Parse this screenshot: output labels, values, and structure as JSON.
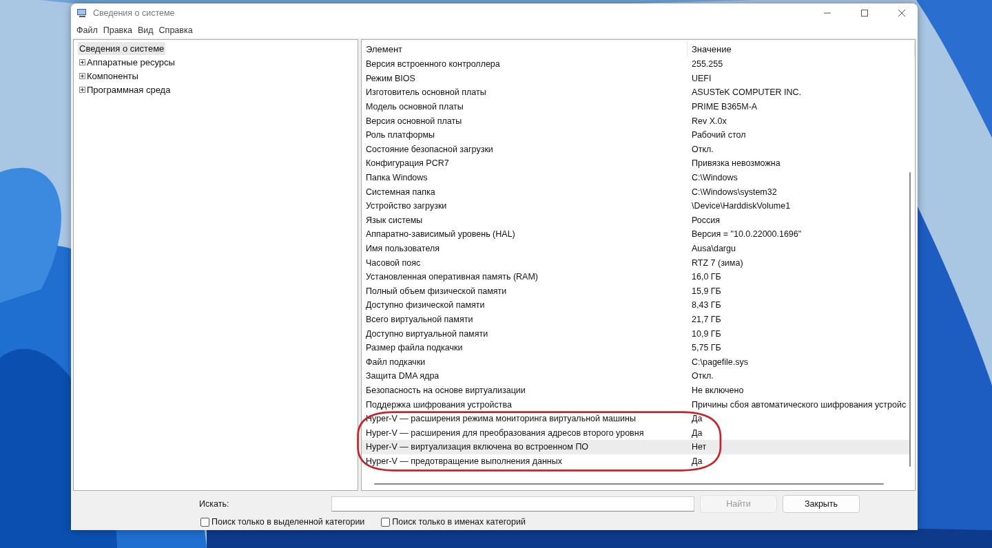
{
  "window": {
    "title": "Сведения о системе"
  },
  "menu": [
    "Файл",
    "Правка",
    "Вид",
    "Справка"
  ],
  "tree": {
    "root": {
      "label": "Сведения о системе",
      "selected": true
    },
    "children": [
      {
        "label": "Аппаратные ресурсы",
        "expanded": false
      },
      {
        "label": "Компоненты",
        "expanded": false
      },
      {
        "label": "Программная среда",
        "expanded": false
      }
    ]
  },
  "table": {
    "columns": [
      "Элемент",
      "Значение"
    ],
    "rows": [
      {
        "item": "Версия встроенного контроллера",
        "value": "255.255",
        "selected": false
      },
      {
        "item": "Режим BIOS",
        "value": "UEFI",
        "selected": false
      },
      {
        "item": "Изготовитель основной платы",
        "value": "ASUSTeK COMPUTER INC.",
        "selected": false
      },
      {
        "item": "Модель основной платы",
        "value": "PRIME B365M-A",
        "selected": false
      },
      {
        "item": "Версия основной платы",
        "value": "Rev X.0x",
        "selected": false
      },
      {
        "item": "Роль платформы",
        "value": "Рабочий стол",
        "selected": false
      },
      {
        "item": "Состояние безопасной загрузки",
        "value": "Откл.",
        "selected": false
      },
      {
        "item": "Конфигурация PCR7",
        "value": "Привязка невозможна",
        "selected": false
      },
      {
        "item": "Папка Windows",
        "value": "C:\\Windows",
        "selected": false
      },
      {
        "item": "Системная папка",
        "value": "C:\\Windows\\system32",
        "selected": false
      },
      {
        "item": "Устройство загрузки",
        "value": "\\Device\\HarddiskVolume1",
        "selected": false
      },
      {
        "item": "Язык системы",
        "value": "Россия",
        "selected": false
      },
      {
        "item": "Аппаратно-зависимый уровень (HAL)",
        "value": "Версия = \"10.0.22000.1696\"",
        "selected": false
      },
      {
        "item": "Имя пользователя",
        "value": "Ausa\\dargu",
        "selected": false
      },
      {
        "item": "Часовой пояс",
        "value": "RTZ 7 (зима)",
        "selected": false
      },
      {
        "item": "Установленная оперативная память (RAM)",
        "value": "16,0 ГБ",
        "selected": false
      },
      {
        "item": "Полный объем физической памяти",
        "value": "15,9 ГБ",
        "selected": false
      },
      {
        "item": "Доступно физической памяти",
        "value": "8,43 ГБ",
        "selected": false
      },
      {
        "item": "Всего виртуальной памяти",
        "value": "21,7 ГБ",
        "selected": false
      },
      {
        "item": "Доступно виртуальной памяти",
        "value": "10,9 ГБ",
        "selected": false
      },
      {
        "item": "Размер файла подкачки",
        "value": "5,75 ГБ",
        "selected": false
      },
      {
        "item": "Файл подкачки",
        "value": "C:\\pagefile.sys",
        "selected": false
      },
      {
        "item": "Защита DMA ядра",
        "value": "Откл.",
        "selected": false
      },
      {
        "item": "Безопасность на основе виртуализации",
        "value": "Не включено",
        "selected": false
      },
      {
        "item": "Поддержка шифрования устройства",
        "value": "Причины сбоя автоматического шифрования устройс",
        "selected": false
      },
      {
        "item": "Hyper-V — расширения режима мониторинга виртуальной машины",
        "value": "Да",
        "selected": false
      },
      {
        "item": "Hyper-V — расширения для преобразования адресов второго уровня",
        "value": "Да",
        "selected": false
      },
      {
        "item": "Hyper-V — виртуализация включена во встроенном ПО",
        "value": "Нет",
        "selected": true
      },
      {
        "item": "Hyper-V — предотвращение выполнения данных",
        "value": "Да",
        "selected": false
      }
    ]
  },
  "search": {
    "label": "Искать:"
  },
  "buttons": [
    {
      "label": "Найти",
      "disabled": true
    },
    {
      "label": "Закрыть",
      "disabled": false
    }
  ],
  "options": [
    {
      "label": "Поиск только в выделенной категории",
      "checked": false
    },
    {
      "label": "Поиск только в именах категорий",
      "checked": false
    }
  ],
  "annotation": {
    "kind": "ellipse",
    "color": "#c0272d"
  }
}
